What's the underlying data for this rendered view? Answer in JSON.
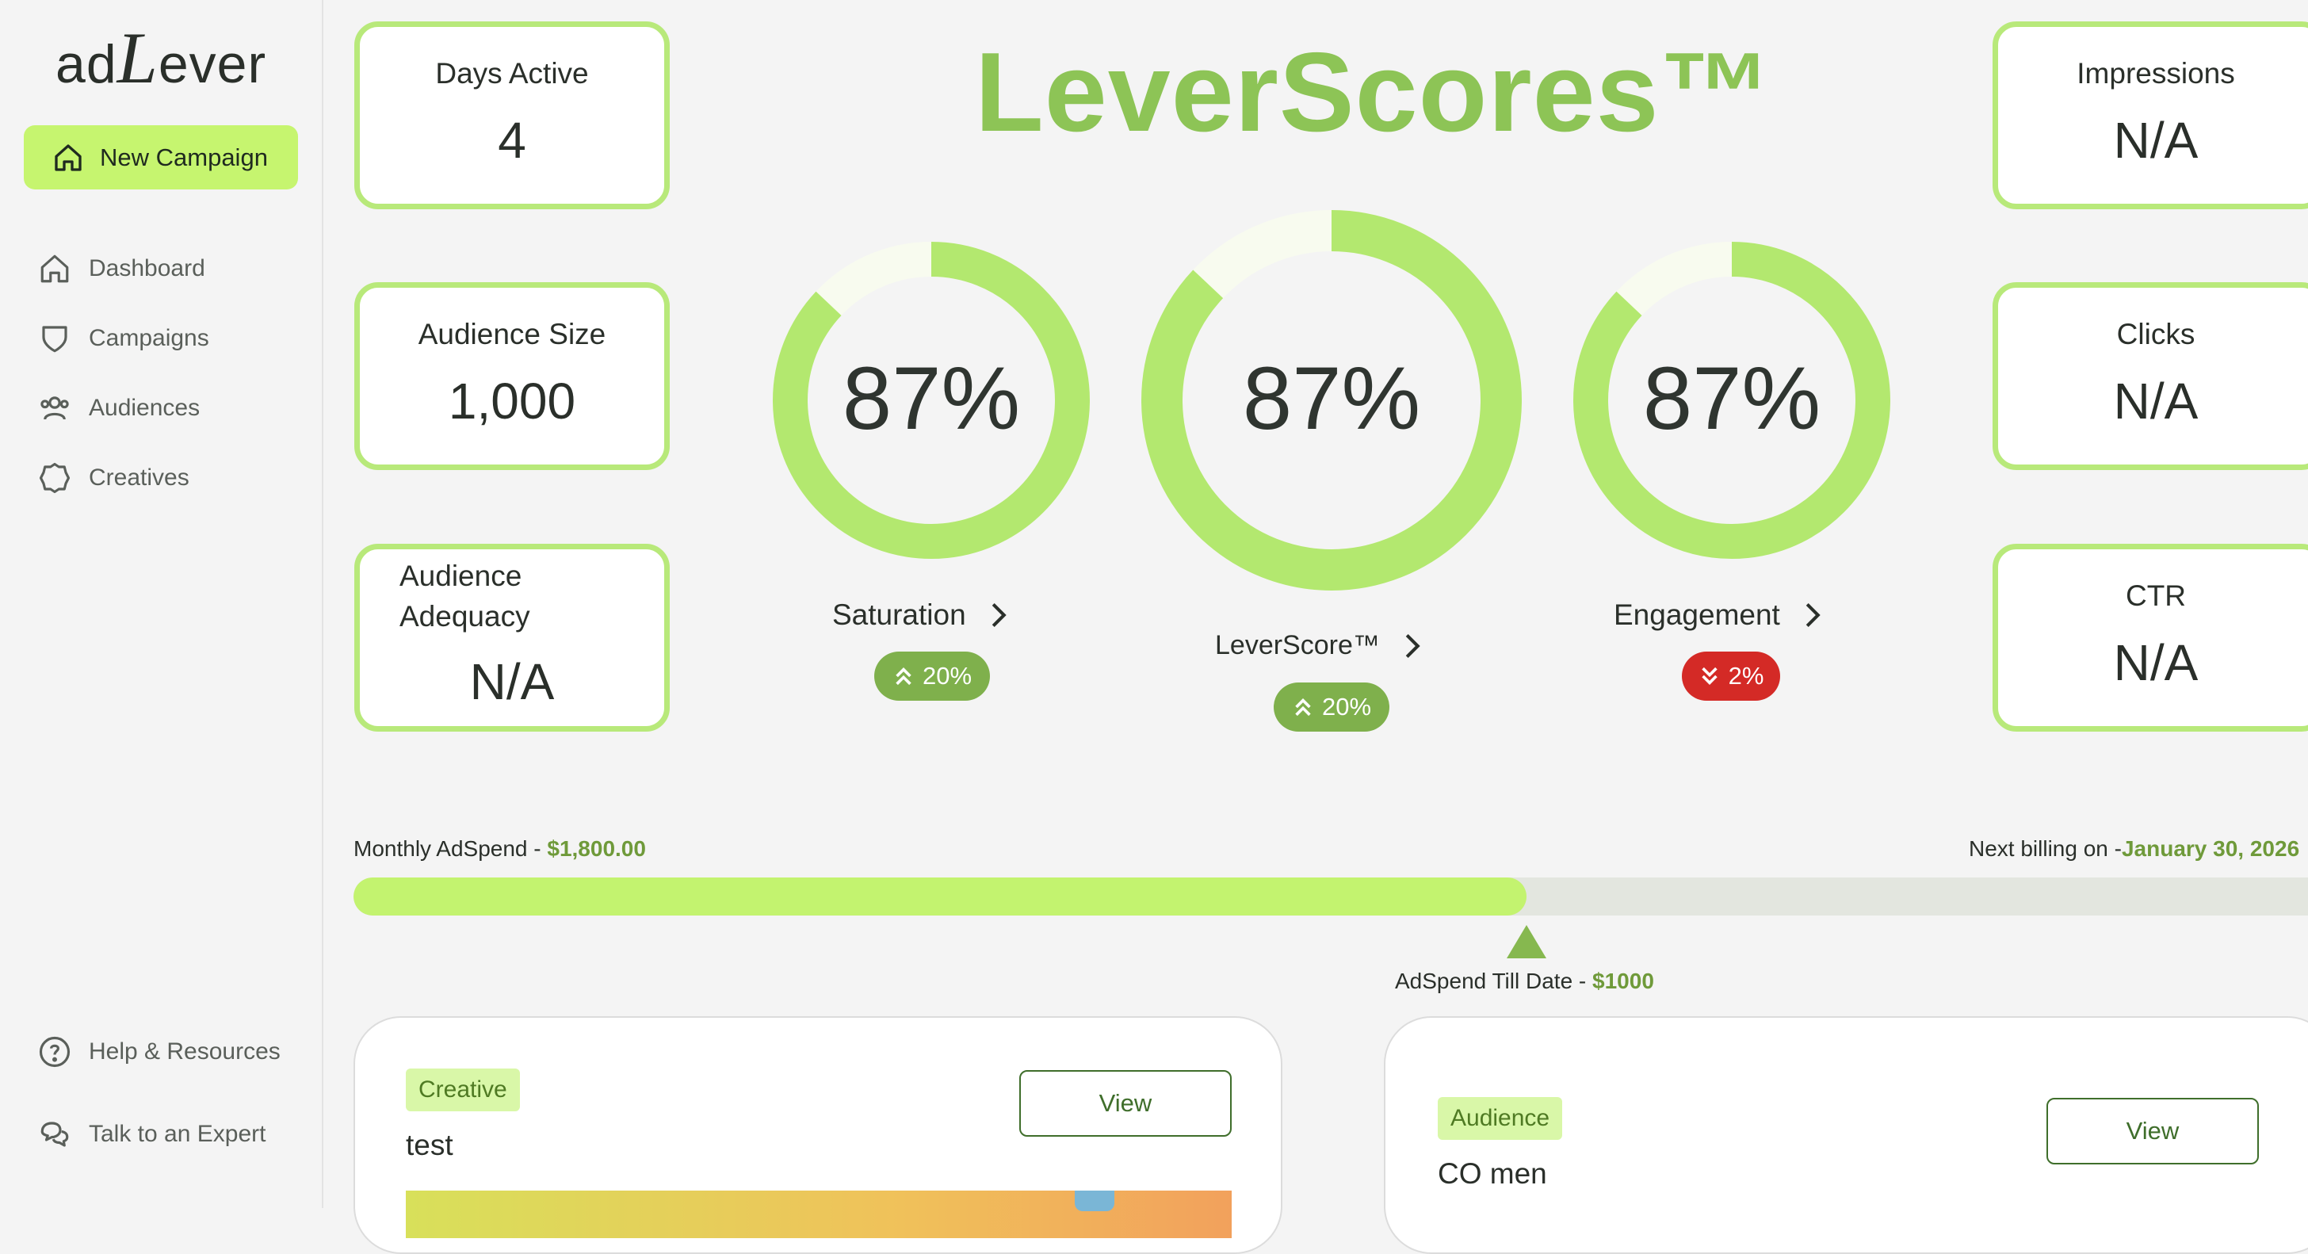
{
  "app": {
    "logo_prefix": "ad",
    "logo_L": "L",
    "logo_suffix": "ever"
  },
  "sidebar": {
    "new_campaign": "New Campaign",
    "items": [
      {
        "label": "Dashboard",
        "icon": "home-icon"
      },
      {
        "label": "Campaigns",
        "icon": "shield-icon"
      },
      {
        "label": "Audiences",
        "icon": "users-icon"
      },
      {
        "label": "Creatives",
        "icon": "badge-icon"
      }
    ],
    "footer": [
      {
        "label": "Help & Resources",
        "icon": "help-icon"
      },
      {
        "label": "Talk to an Expert",
        "icon": "chat-icon"
      }
    ]
  },
  "page_title": "LeverScores™",
  "left_cards": [
    {
      "label": "Days Active",
      "value": "4"
    },
    {
      "label": "Audience Size",
      "value": "1,000"
    },
    {
      "label": "Audience Adequacy",
      "value": "N/A"
    }
  ],
  "right_cards": [
    {
      "label": "Impressions",
      "value": "N/A"
    },
    {
      "label": "Clicks",
      "value": "N/A"
    },
    {
      "label": "CTR",
      "value": "N/A"
    }
  ],
  "scores": [
    {
      "name": "Saturation",
      "value_text": "87%",
      "fraction": 0.87,
      "change": "20%",
      "direction": "up",
      "badge_color": "#7fb04c"
    },
    {
      "name": "LeverScore™",
      "value_text": "87%",
      "fraction": 0.87,
      "change": "20%",
      "direction": "up",
      "badge_color": "#7fb04c"
    },
    {
      "name": "Engagement",
      "value_text": "87%",
      "fraction": 0.87,
      "change": "2%",
      "direction": "down",
      "badge_color": "#d42a26"
    }
  ],
  "adspend": {
    "monthly_label": "Monthly AdSpend - ",
    "monthly_value": "$1,800.00",
    "billing_label": "Next billing on -",
    "billing_date": "January 30, 2026",
    "till_date_label": "AdSpend Till Date - ",
    "till_date_value": "$1000",
    "progress_fraction": 0.6
  },
  "panels": [
    {
      "tag": "Creative",
      "name": "test",
      "button": "View"
    },
    {
      "tag": "Audience",
      "name": "CO men",
      "button": "View"
    }
  ],
  "colors": {
    "accent": "#c6f56f",
    "ring": "#b3e86f",
    "title": "#8dc456",
    "down": "#d42a26",
    "up": "#7fb04c"
  }
}
